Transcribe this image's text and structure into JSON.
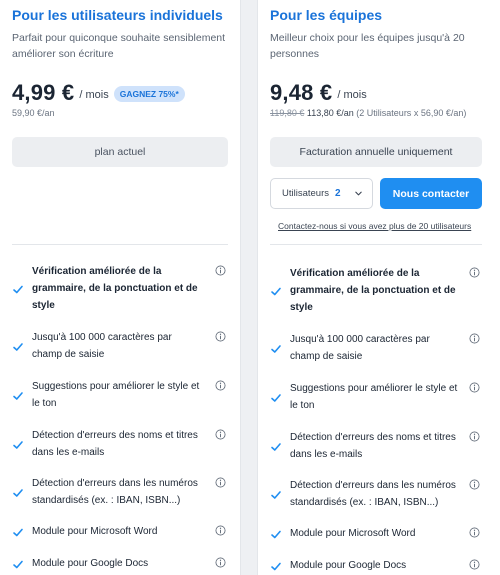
{
  "colors": {
    "accent": "#1a73d9",
    "button_primary": "#1f8ef1",
    "badge_bg": "#cfe2fb",
    "text": "#1b2533"
  },
  "individual": {
    "title": "Pour les utilisateurs individuels",
    "description": "Parfait pour quiconque souhaite sensiblement améliorer son écriture",
    "price": "4,99 €",
    "per_month": "/ mois",
    "badge": "GAGNEZ 75%*",
    "yearly": "59,90 €/an",
    "button": "plan actuel",
    "features": [
      "Vérification améliorée de la grammaire, de la ponctuation et de style",
      "Jusqu'à 100 000 caractères par champ de saisie",
      "Suggestions pour améliorer le style et le ton",
      "Détection d'erreurs des noms et titres dans les e-mails",
      "Détection d'erreurs dans les numéros standardisés (ex. : IBAN, ISBN...)",
      "Module pour Microsoft Word",
      "Module pour Google Docs"
    ]
  },
  "teams": {
    "title": "Pour les équipes",
    "description": "Meilleur choix pour les équipes jusqu'à 20 personnes",
    "price": "9,48 €",
    "per_month": "/ mois",
    "yearly_old": "119,80 €",
    "yearly_new": "113,80 €/an",
    "yearly_detail": "(2 Utilisateurs x 56,90 €/an)",
    "button_billing": "Facturation annuelle uniquement",
    "users_label": "Utilisateurs",
    "users_count": "2",
    "contact_button": "Nous contacter",
    "contact_link": "Contactez-nous si vous avez plus de 20 utilisateurs",
    "features": [
      "Vérification améliorée de la grammaire, de la ponctuation et de style",
      "Jusqu'à 100 000 caractères par champ de saisie",
      "Suggestions pour améliorer le style et le ton",
      "Détection d'erreurs des noms et titres dans les e-mails",
      "Détection d'erreurs dans les numéros standardisés (ex. : IBAN, ISBN...)",
      "Module pour Microsoft Word",
      "Module pour Google Docs"
    ]
  },
  "icons": {
    "check": "check-icon",
    "info": "info-icon",
    "dropdown": "chevron-down-icon"
  }
}
